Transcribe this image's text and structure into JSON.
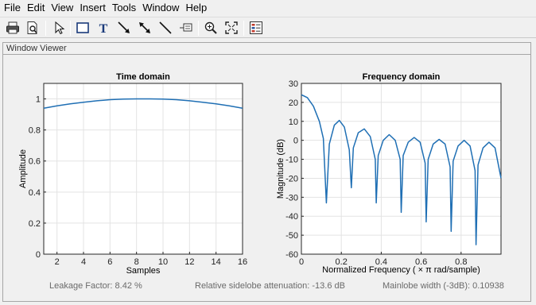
{
  "menu": [
    "File",
    "Edit",
    "View",
    "Insert",
    "Tools",
    "Window",
    "Help"
  ],
  "toolbar": {
    "icons": [
      "print-icon",
      "print-preview-icon",
      "pointer-icon",
      "rectangle-icon",
      "text-icon",
      "arrow-icon",
      "double-arrow-icon",
      "line-icon",
      "data-cursor-icon",
      "zoom-in-icon",
      "full-view-icon",
      "legend-icon"
    ]
  },
  "panel": {
    "title": "Window Viewer"
  },
  "status": {
    "leakage": "Leakage Factor: 8.42 %",
    "sidelobe": "Relative sidelobe attenuation: -13.6 dB",
    "mainlobe": "Mainlobe width (-3dB): 0.10938"
  },
  "chart_data": [
    {
      "type": "line",
      "title": "Time domain",
      "xlabel": "Samples",
      "ylabel": "Amplitude",
      "xlim": [
        1,
        16
      ],
      "ylim": [
        0,
        1.1
      ],
      "xticks": [
        2,
        4,
        6,
        8,
        10,
        12,
        14,
        16
      ],
      "yticks": [
        0,
        0.2,
        0.4,
        0.6,
        0.8,
        1
      ],
      "ytick_labels": [
        "0",
        "0.2",
        "0.4",
        "0.6",
        "0.8",
        "1"
      ],
      "grid": true,
      "color": "#1f6fb4",
      "x": [
        1,
        2,
        3,
        4,
        5,
        6,
        7,
        8,
        9,
        10,
        11,
        12,
        13,
        14,
        15,
        16
      ],
      "y": [
        0.94,
        0.955,
        0.968,
        0.979,
        0.988,
        0.995,
        0.999,
        1.0,
        1.0,
        0.999,
        0.995,
        0.988,
        0.979,
        0.968,
        0.955,
        0.94
      ]
    },
    {
      "type": "line",
      "title": "Frequency domain",
      "xlabel": "Normalized  Frequency  ( × π  rad/sample)",
      "ylabel": "Magnitude (dB)",
      "xlim": [
        0,
        1
      ],
      "ylim": [
        -60,
        30
      ],
      "xticks": [
        0,
        0.2,
        0.4,
        0.6,
        0.8
      ],
      "xtick_labels": [
        "0",
        "0.2",
        "0.4",
        "0.6",
        "0.8"
      ],
      "yticks": [
        -60,
        -50,
        -40,
        -30,
        -20,
        -10,
        0,
        10,
        20,
        30
      ],
      "grid": true,
      "color": "#1f6fb4",
      "x": [
        0,
        0.03,
        0.06,
        0.09,
        0.11,
        0.125,
        0.14,
        0.165,
        0.19,
        0.215,
        0.24,
        0.25,
        0.26,
        0.285,
        0.315,
        0.345,
        0.37,
        0.375,
        0.385,
        0.41,
        0.44,
        0.47,
        0.495,
        0.5,
        0.51,
        0.535,
        0.565,
        0.595,
        0.62,
        0.625,
        0.635,
        0.66,
        0.69,
        0.72,
        0.745,
        0.75,
        0.76,
        0.785,
        0.815,
        0.845,
        0.87,
        0.875,
        0.885,
        0.91,
        0.94,
        0.97,
        1.0
      ],
      "y": [
        24,
        22.5,
        18,
        10,
        1,
        -33,
        -2,
        8,
        10.5,
        7,
        -5,
        -25,
        -4,
        4,
        6,
        2,
        -10,
        -33,
        -8,
        0,
        3,
        0,
        -10,
        -38,
        -8,
        -1,
        1.5,
        -1,
        -12,
        -43,
        -10,
        -2,
        0.5,
        -2,
        -14,
        -48,
        -11,
        -3,
        0,
        -3,
        -16,
        -55,
        -13,
        -4,
        -1,
        -4,
        -20
      ]
    }
  ]
}
